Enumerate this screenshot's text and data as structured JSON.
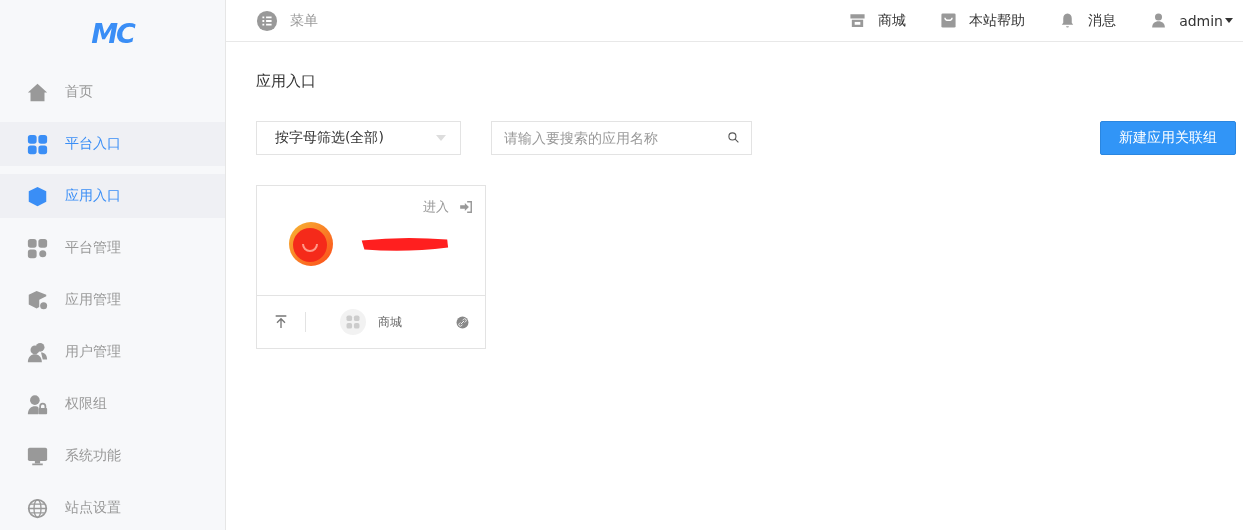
{
  "logo": "MC",
  "sidebar": {
    "items": [
      {
        "label": "首页",
        "selected": false
      },
      {
        "label": "平台入口",
        "selected": true
      },
      {
        "label": "应用入口",
        "selected": true
      },
      {
        "label": "平台管理",
        "selected": false
      },
      {
        "label": "应用管理",
        "selected": false
      },
      {
        "label": "用户管理",
        "selected": false
      },
      {
        "label": "权限组",
        "selected": false
      },
      {
        "label": "系统功能",
        "selected": false
      },
      {
        "label": "站点设置",
        "selected": false
      }
    ]
  },
  "header": {
    "menu_label": "菜单",
    "links": [
      {
        "label": "商城"
      },
      {
        "label": "本站帮助"
      },
      {
        "label": "消息"
      },
      {
        "label": "admin"
      }
    ]
  },
  "page_title": "应用入口",
  "filter": {
    "value": "按字母筛选(全部)"
  },
  "search": {
    "placeholder": "请输入要搜索的应用名称"
  },
  "new_button": "新建应用关联组",
  "cards": [
    {
      "enter_label": "进入",
      "shop_label": "商城"
    }
  ]
}
